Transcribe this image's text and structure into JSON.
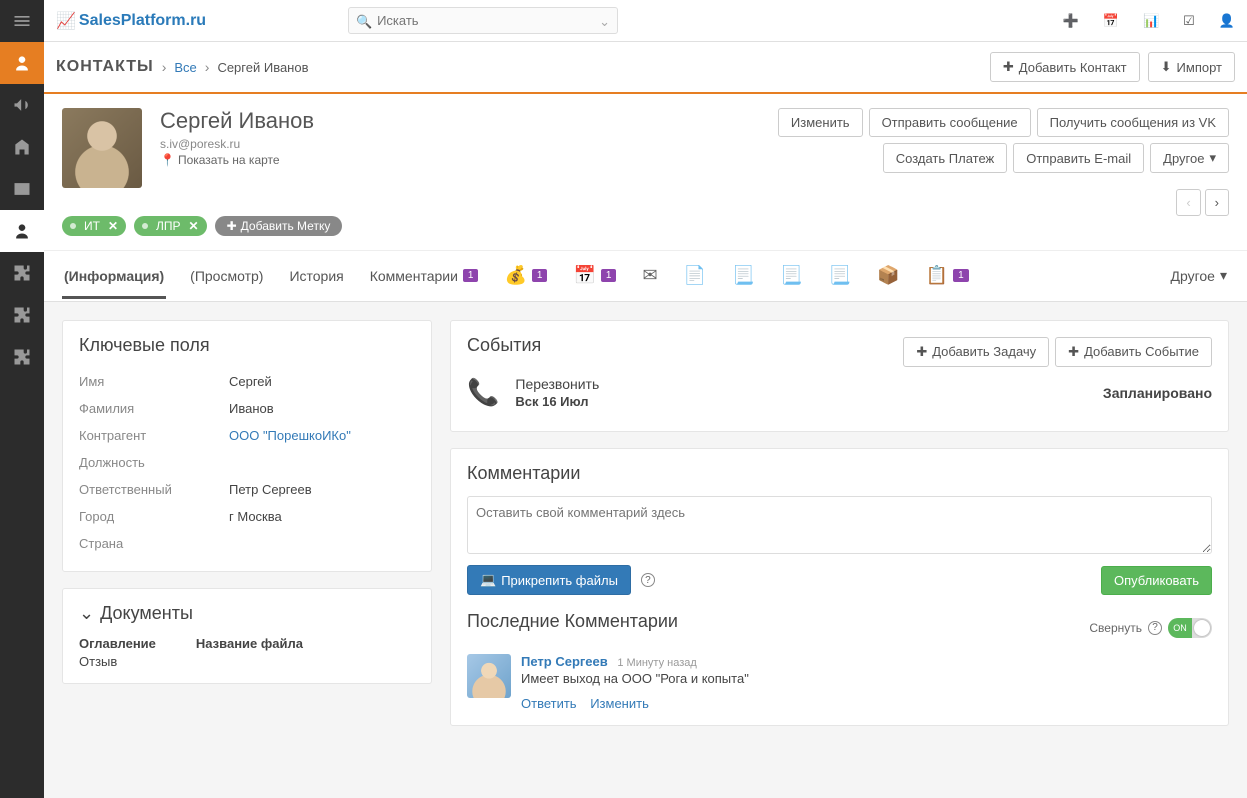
{
  "logo": "SalesPlatform.ru",
  "search": {
    "placeholder": "Искать"
  },
  "breadcrumb": {
    "module": "КОНТАКТЫ",
    "all": "Все",
    "current": "Сергей Иванов"
  },
  "header_buttons": {
    "add_contact": "Добавить Контакт",
    "import": "Импорт"
  },
  "contact": {
    "name": "Сергей Иванов",
    "email": "s.iv@poresk.ru",
    "map_link": "Показать на карте"
  },
  "hero_actions": {
    "edit": "Изменить",
    "send_msg": "Отправить сообщение",
    "get_vk": "Получить сообщения из VK",
    "create_payment": "Создать Платеж",
    "send_email": "Отправить E-mail",
    "other": "Другое"
  },
  "tags": {
    "t1": "ИТ",
    "t2": "ЛПР",
    "add": "Добавить Метку"
  },
  "tabs": {
    "info": "(Информация)",
    "views": "(Просмотр)",
    "history": "История",
    "comments": "Комментарии",
    "comments_badge": "1",
    "money_badge": "1",
    "cal_badge": "1",
    "doc_badge": "1",
    "other": "Другое"
  },
  "key_fields": {
    "heading": "Ключевые поля",
    "first_name_k": "Имя",
    "first_name_v": "Сергей",
    "last_name_k": "Фамилия",
    "last_name_v": "Иванов",
    "account_k": "Контрагент",
    "account_v": "ООО \"ПорешкоИКо\"",
    "position_k": "Должность",
    "position_v": "",
    "owner_k": "Ответственный",
    "owner_v": "Петр Сергеев",
    "city_k": "Город",
    "city_v": "г Москва",
    "country_k": "Страна",
    "country_v": ""
  },
  "documents": {
    "heading": "Документы",
    "col1_head": "Оглавление",
    "col1_val": "Отзыв",
    "col2_head": "Название файла"
  },
  "events": {
    "heading": "События",
    "add_task": "Добавить Задачу",
    "add_event": "Добавить Событие",
    "item_title": "Перезвонить",
    "item_date": "Вск 16 Июл",
    "item_status": "Запланировано"
  },
  "comments": {
    "heading": "Комментарии",
    "placeholder": "Оставить свой комментарий здесь",
    "attach": "Прикрепить файлы",
    "publish": "Опубликовать",
    "recent_heading": "Последние Комментарии",
    "collapse": "Свернуть",
    "toggle": "ON",
    "author": "Петр Сергеев",
    "time": "1 Минуту назад",
    "text": "Имеет выход на ООО \"Рога и копыта\"",
    "reply": "Ответить",
    "edit": "Изменить"
  }
}
